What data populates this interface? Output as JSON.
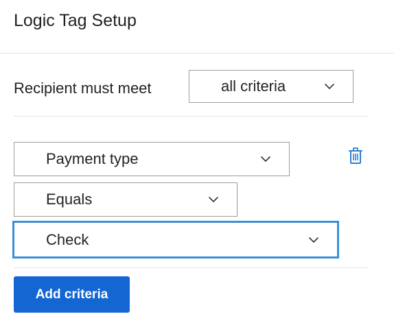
{
  "panel": {
    "title": "Logic Tag Setup"
  },
  "match": {
    "label": "Recipient must meet",
    "selected": "all criteria"
  },
  "criteria": [
    {
      "field": "Payment type",
      "operator": "Equals",
      "value": "Check"
    }
  ],
  "actions": {
    "add_label": "Add criteria"
  },
  "icons": {
    "dropdown": "chevron-down-icon",
    "delete": "trash-icon"
  },
  "colors": {
    "primary": "#1466d3",
    "focus_border": "#3b8fd8",
    "trash_icon": "#2b7fd4"
  }
}
